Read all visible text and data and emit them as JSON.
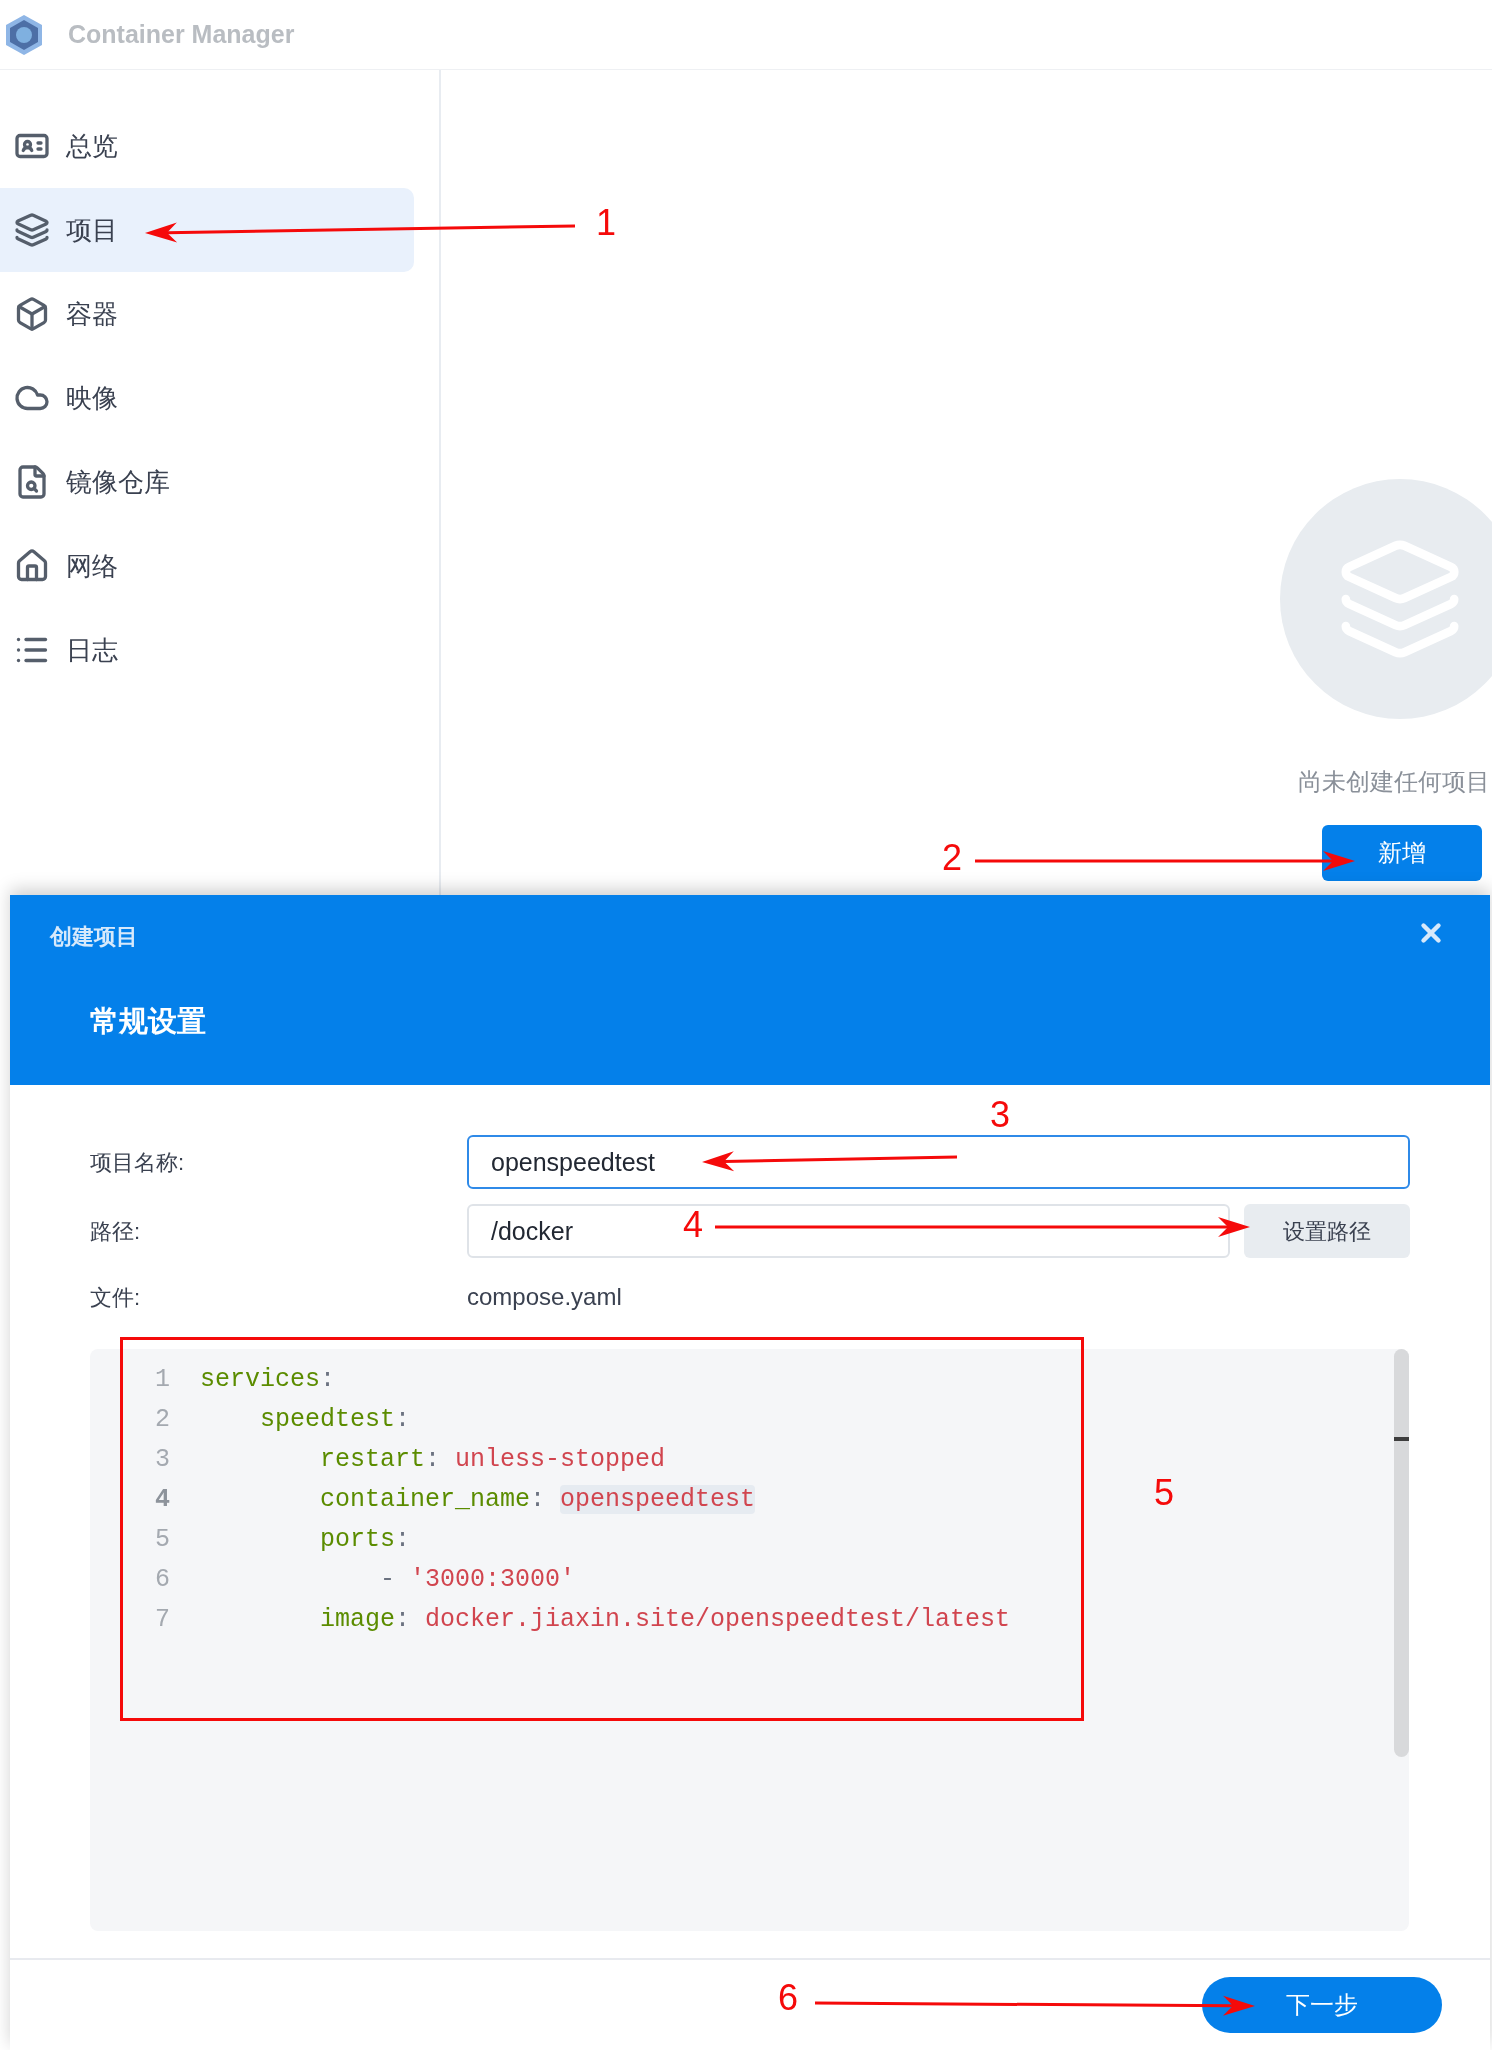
{
  "app": {
    "title": "Container Manager"
  },
  "sidebar": {
    "items": [
      {
        "kind": "overview",
        "label": "总览",
        "selected": false
      },
      {
        "kind": "project",
        "label": "项目",
        "selected": true
      },
      {
        "kind": "container",
        "label": "容器",
        "selected": false
      },
      {
        "kind": "image",
        "label": "映像",
        "selected": false
      },
      {
        "kind": "registry",
        "label": "镜像仓库",
        "selected": false
      },
      {
        "kind": "network",
        "label": "网络",
        "selected": false
      },
      {
        "kind": "log",
        "label": "日志",
        "selected": false
      }
    ]
  },
  "empty_state": {
    "message": "尚未创建任何项目",
    "button": "新增"
  },
  "dialog": {
    "title": "创建项目",
    "section": "常规设置",
    "fields": [
      {
        "kind": "input",
        "label": "项目名称:",
        "value": "openspeedtest",
        "focused": true
      },
      {
        "kind": "path",
        "label": "路径:",
        "value": "/docker",
        "button": "设置路径",
        "focused": false
      },
      {
        "kind": "static",
        "label": "文件:",
        "value": "compose.yaml"
      }
    ],
    "editor": {
      "lines": [
        {
          "number": "1",
          "kind": "root",
          "current": false,
          "tokens": [
            {
              "kind": "key",
              "text": "services"
            },
            {
              "kind": "punct",
              "text": ":"
            }
          ]
        },
        {
          "number": "2",
          "kind": "service",
          "current": false,
          "tokens": [
            {
              "kind": "key",
              "text": "speedtest"
            },
            {
              "kind": "punct",
              "text": ":"
            }
          ]
        },
        {
          "number": "3",
          "kind": "property",
          "current": false,
          "tokens": [
            {
              "kind": "key",
              "text": "restart"
            },
            {
              "kind": "punct",
              "text": ": "
            },
            {
              "kind": "value",
              "text": "unless-stopped"
            }
          ]
        },
        {
          "number": "4",
          "kind": "property",
          "current": true,
          "tokens": [
            {
              "kind": "key",
              "text": "container_name"
            },
            {
              "kind": "punct",
              "text": ": "
            },
            {
              "kind": "match",
              "text": "openspeedtest"
            }
          ]
        },
        {
          "number": "5",
          "kind": "property",
          "current": false,
          "tokens": [
            {
              "kind": "key",
              "text": "ports"
            },
            {
              "kind": "punct",
              "text": ":"
            }
          ]
        },
        {
          "number": "6",
          "kind": "list_item",
          "current": false,
          "tokens": [
            {
              "kind": "punct",
              "text": "- "
            },
            {
              "kind": "value",
              "text": "'3000:3000'"
            }
          ]
        },
        {
          "number": "7",
          "kind": "property",
          "current": false,
          "tokens": [
            {
              "kind": "key",
              "text": "image"
            },
            {
              "kind": "punct",
              "text": ": "
            },
            {
              "kind": "value",
              "text": "docker.jiaxin.site/openspeedtest/latest"
            }
          ]
        }
      ]
    },
    "next_button": "下一步"
  },
  "annotations": [
    {
      "label": "1"
    },
    {
      "label": "2"
    },
    {
      "label": "3"
    },
    {
      "label": "4"
    },
    {
      "label": "5"
    },
    {
      "label": "6"
    }
  ]
}
